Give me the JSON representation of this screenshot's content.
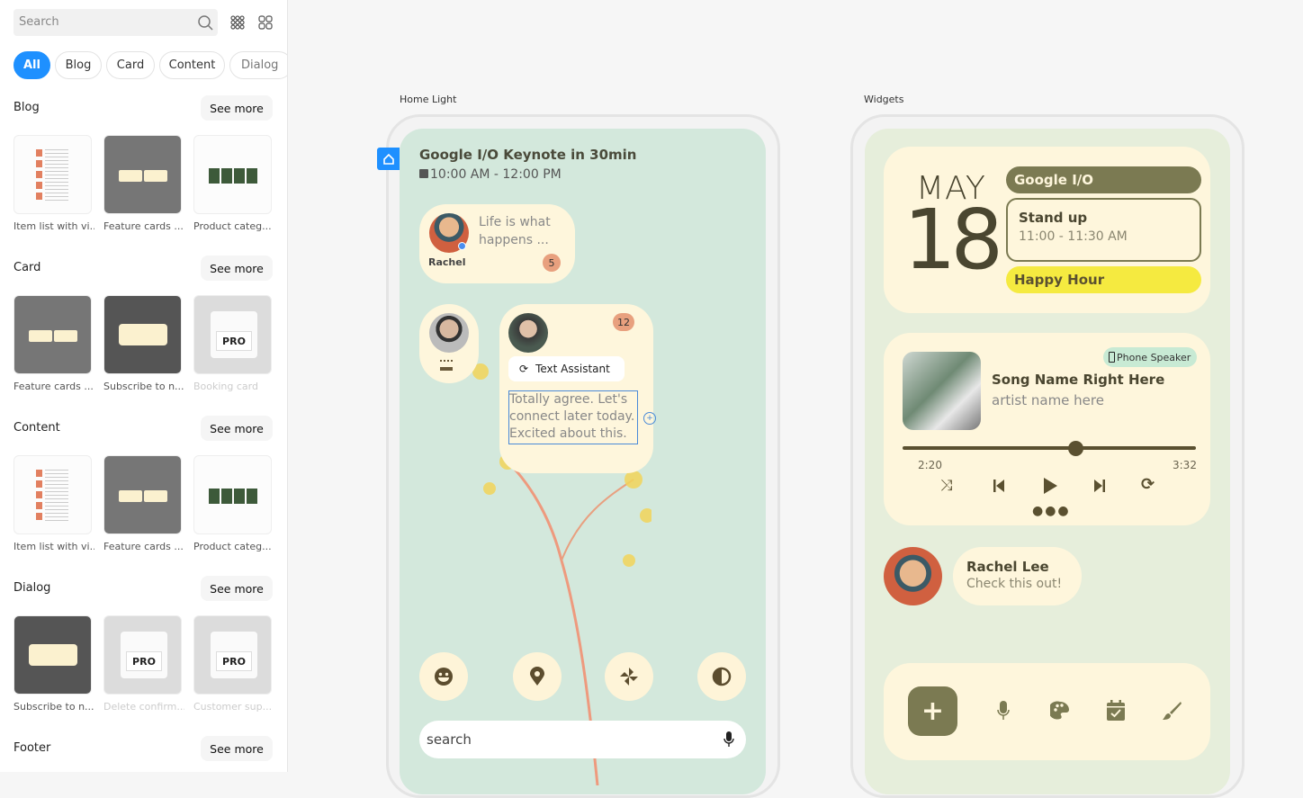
{
  "sidebar": {
    "search_placeholder": "Search",
    "chips": [
      "All",
      "Blog",
      "Card",
      "Content",
      "Dialog"
    ],
    "see_more": "See more",
    "sections": [
      {
        "title": "Blog",
        "items": [
          {
            "label": "Item list with vi...",
            "style": "light",
            "kind": "list"
          },
          {
            "label": "Feature cards ...",
            "style": "gray",
            "kind": "cards"
          },
          {
            "label": "Product categ...",
            "style": "light",
            "kind": "products"
          }
        ]
      },
      {
        "title": "Card",
        "items": [
          {
            "label": "Feature cards ...",
            "style": "gray",
            "kind": "cards"
          },
          {
            "label": "Subscribe to n...",
            "style": "dark",
            "kind": "subscribe"
          },
          {
            "label": "Booking card",
            "style": "pro",
            "kind": "pro",
            "disabled": true
          }
        ]
      },
      {
        "title": "Content",
        "items": [
          {
            "label": "Item list with vi...",
            "style": "light",
            "kind": "list"
          },
          {
            "label": "Feature cards ...",
            "style": "gray",
            "kind": "cards"
          },
          {
            "label": "Product categ...",
            "style": "light",
            "kind": "products"
          }
        ]
      },
      {
        "title": "Dialog",
        "items": [
          {
            "label": "Subscribe to n...",
            "style": "dark",
            "kind": "subscribe"
          },
          {
            "label": "Delete confirm...",
            "style": "pro",
            "kind": "pro",
            "disabled": true
          },
          {
            "label": "Customer sup...",
            "style": "pro",
            "kind": "pro",
            "disabled": true
          }
        ]
      },
      {
        "title": "Footer",
        "items": []
      }
    ],
    "pro_label": "PRO"
  },
  "home": {
    "frame_label": "Home Light",
    "event_title": "Google I/O Keynote in 30min",
    "event_time": "10:00 AM - 12:00 PM",
    "msg1": {
      "text": "Life is what happens ...",
      "name": "Rachel",
      "badge": "5"
    },
    "msg2": {
      "badge": "12",
      "assistant": "Text Assistant",
      "text": "Totally agree. Let's connect later today. Excited about this."
    },
    "quick_icons": [
      "emoji-icon",
      "location-icon",
      "pinwheel-icon",
      "contrast-icon"
    ],
    "search_placeholder": "search"
  },
  "widgets": {
    "frame_label": "Widgets",
    "month": "MAY",
    "day": "18",
    "events": [
      {
        "title": "Google I/O"
      },
      {
        "title": "Stand up",
        "time": "11:00 - 11:30 AM"
      },
      {
        "title": "Happy Hour"
      }
    ],
    "player": {
      "output": "Phone Speaker",
      "song": "Song Name Right Here",
      "artist": "artist name here",
      "elapsed": "2:20",
      "total": "3:32",
      "progress": 0.59
    },
    "contact": {
      "name": "Rachel Lee",
      "message": "Check this out!"
    }
  },
  "colors": {
    "accent": "#1e90ff",
    "olive": "#7b7a52",
    "cream": "#fef6dc",
    "yellow": "#f5ea40",
    "mint": "#d3e8dc",
    "badge": "#e8a07e"
  }
}
